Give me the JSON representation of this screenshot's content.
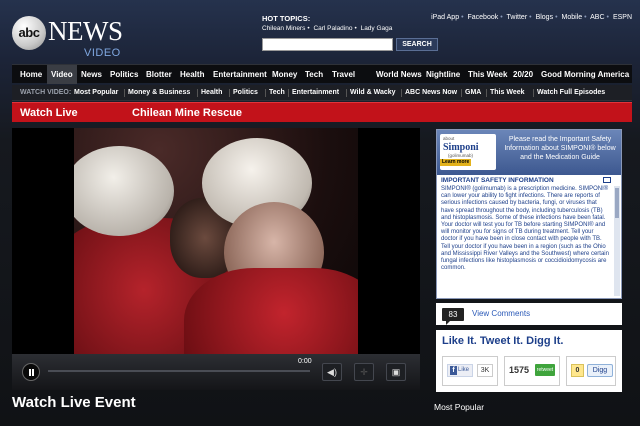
{
  "header": {
    "logo_abc": "abc",
    "logo_news": "NEWS",
    "logo_video": "VIDEO",
    "hot_topics_label": "HOT TOPICS:",
    "hot_topics": [
      "Chilean Miners",
      "Carl Paladino",
      "Lady Gaga"
    ],
    "search_value": "",
    "search_button": "SEARCH",
    "top_links": [
      "iPad App",
      "Facebook",
      "Twitter",
      "Blogs",
      "Mobile",
      "ABC",
      "ESPN"
    ]
  },
  "main_nav": [
    "Home",
    "Video",
    "News",
    "Politics",
    "Blotter",
    "Health",
    "Entertainment",
    "Money",
    "Tech",
    "Travel",
    "World News",
    "Nightline",
    "This Week",
    "20/20",
    "Good Morning America"
  ],
  "sub_nav": {
    "label": "WATCH VIDEO:",
    "items": [
      "Most Popular",
      "Money & Business",
      "Health",
      "Politics",
      "Tech",
      "Entertainment",
      "Wild & Wacky",
      "ABC News Now",
      "GMA",
      "This Week",
      "Watch Full Episodes"
    ]
  },
  "live_bar": {
    "watch_live": "Watch Live",
    "story": "Chilean Mine Rescue"
  },
  "player": {
    "time": "0:00",
    "progress": 0
  },
  "watch_live_event": "Watch Live Event",
  "ad": {
    "about": "about",
    "brand": "Simponi",
    "generic": "(golimumab)",
    "learn_more": "Learn more",
    "title": "Please read the Important Safety Information about SIMPONI® below and the Medication Guide",
    "safety_title": "IMPORTANT SAFETY INFORMATION",
    "body": "SIMPONI® (golimumab) is a prescription medicine. SIMPONI® can lower your ability to fight infections. There are reports of serious infections caused by bacteria, fungi, or viruses that have spread throughout the body, including tuberculosis (TB) and histoplasmosis. Some of these infections have been fatal. Your doctor will test you for TB before starting SIMPONI® and will monitor you for signs of TB during treatment. Tell your doctor if you have been in close contact with people with TB. Tell your doctor if you have been in a region (such as the Ohio and Mississippi River Valleys and the Southwest) where certain fungal infections like histoplasmosis or coccidioidomycosis are common."
  },
  "comments": {
    "count": "83",
    "label": "View Comments"
  },
  "social": {
    "title": "Like It. Tweet It. Digg It.",
    "fb_label": "Like",
    "fb_count": "3K",
    "tw_count": "1575",
    "tw_label": "retweet",
    "digg_count": "0",
    "digg_label": "Digg"
  },
  "most_popular": "Most Popular",
  "colors": {
    "live_red": "#c2121a",
    "link_blue": "#2b5ab8",
    "ad_blue": "#1d3f8a"
  }
}
